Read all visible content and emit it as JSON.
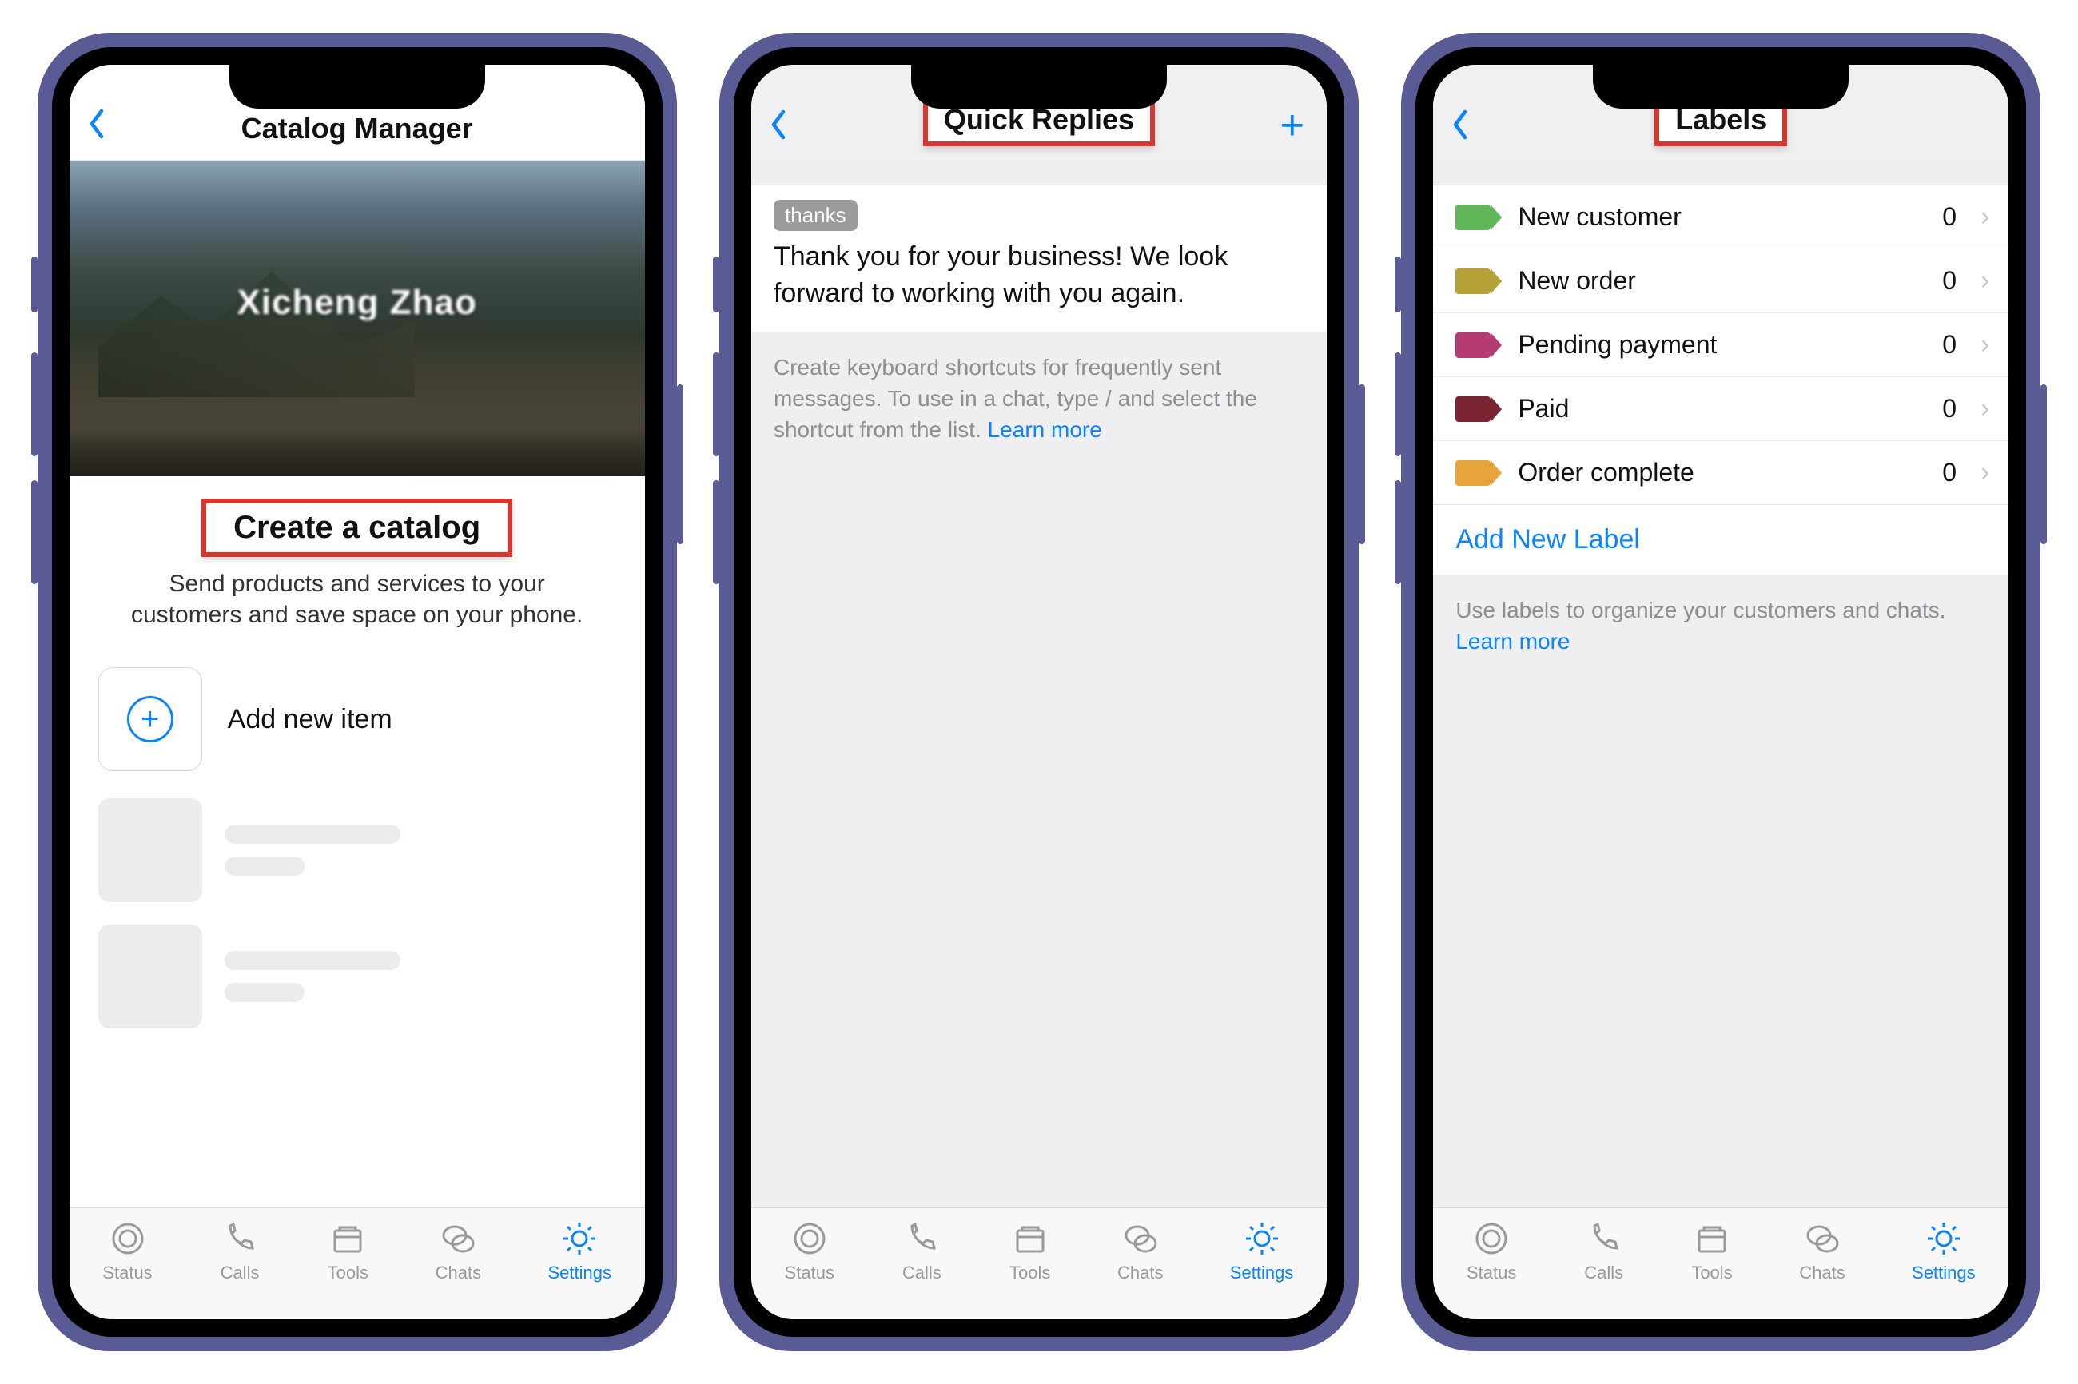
{
  "tabbar": {
    "items": [
      {
        "label": "Status"
      },
      {
        "label": "Calls"
      },
      {
        "label": "Tools"
      },
      {
        "label": "Chats"
      },
      {
        "label": "Settings"
      }
    ],
    "active_index": 4
  },
  "phone1": {
    "title": "Catalog Manager",
    "hero_name": "Xicheng Zhao",
    "create_catalog": "Create a catalog",
    "subtitle": "Send products and services to your customers and save space on your phone.",
    "add_item": "Add new item"
  },
  "phone2": {
    "title": "Quick Replies",
    "reply_tag": "thanks",
    "reply_body": "Thank you for your business! We look forward to working with you again.",
    "helper": "Create keyboard shortcuts for frequently sent messages. To use in a chat, type / and select the shortcut from the list. ",
    "learn_more": "Learn more"
  },
  "phone3": {
    "title": "Labels",
    "labels": [
      {
        "name": "New customer",
        "count": 0,
        "color": "c-green"
      },
      {
        "name": "New order",
        "count": 0,
        "color": "c-olive"
      },
      {
        "name": "Pending payment",
        "count": 0,
        "color": "c-pink"
      },
      {
        "name": "Paid",
        "count": 0,
        "color": "c-maroon"
      },
      {
        "name": "Order complete",
        "count": 0,
        "color": "c-orange"
      }
    ],
    "add_label": "Add New Label",
    "helper": "Use labels to organize your customers and chats. ",
    "learn_more": "Learn more"
  }
}
